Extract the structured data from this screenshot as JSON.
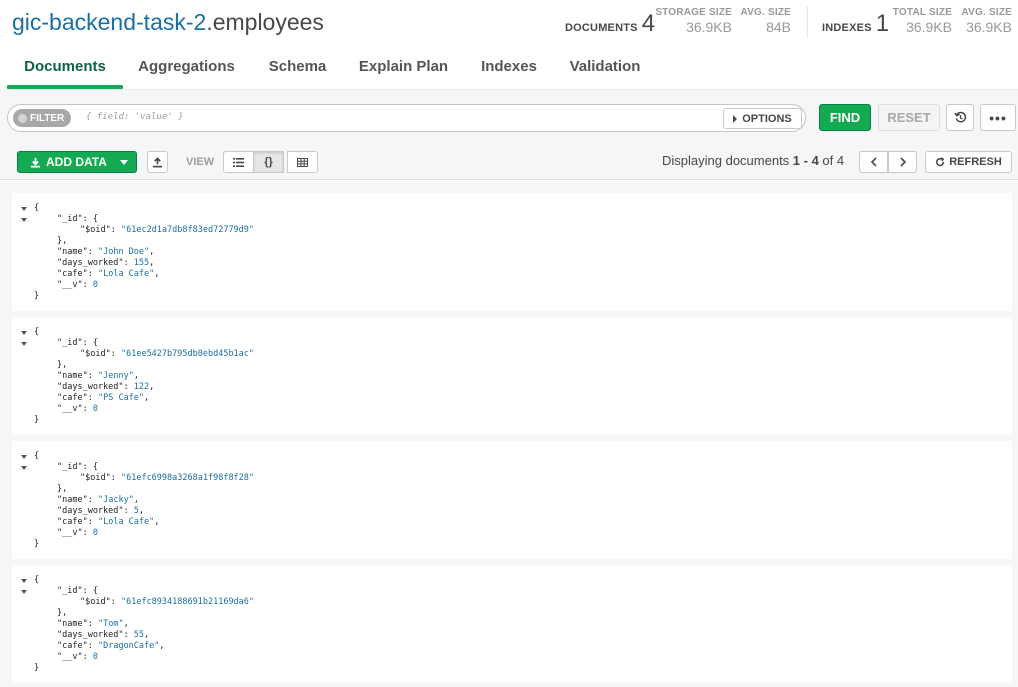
{
  "header": {
    "db": "gic-backend-task-2",
    "collection": ".employees",
    "documents_label": "DOCUMENTS",
    "documents_count": "4",
    "storage_size_label": "STORAGE SIZE",
    "storage_size": "36.9KB",
    "avg_size_label": "AVG. SIZE",
    "avg_size": "84B",
    "indexes_label": "INDEXES",
    "indexes_count": "1",
    "total_size_label": "TOTAL SIZE",
    "total_size": "36.9KB",
    "idx_avg_size_label": "AVG. SIZE",
    "idx_avg_size": "36.9KB"
  },
  "tabs": [
    {
      "label": "Documents",
      "active": true
    },
    {
      "label": "Aggregations"
    },
    {
      "label": "Schema"
    },
    {
      "label": "Explain Plan"
    },
    {
      "label": "Indexes"
    },
    {
      "label": "Validation"
    }
  ],
  "query": {
    "filter_label": "FILTER",
    "filter_placeholder": "{ field: 'value' }",
    "options_label": "OPTIONS",
    "find_label": "FIND",
    "reset_label": "RESET",
    "more_label": "•••"
  },
  "toolbar": {
    "add_data_label": "ADD DATA",
    "view_label": "VIEW",
    "view_json_label": "{}",
    "paging_prefix": "Displaying documents ",
    "paging_range": "1 - 4",
    "paging_of": " of ",
    "paging_total": "4",
    "refresh_label": "REFRESH"
  },
  "documents": [
    {
      "oid": "61ec2d1a7db8f83ed72779d9",
      "name": "John Doe",
      "days_worked": "155",
      "cafe": "Lola Cafe",
      "v": "0"
    },
    {
      "oid": "61ee5427b795db0ebd45b1ac",
      "name": "Jenny",
      "days_worked": "122",
      "cafe": "PS Cafe",
      "v": "0"
    },
    {
      "oid": "61efc6998a3268a1f98f8f28",
      "name": "Jacky",
      "days_worked": "5",
      "cafe": "Lola Cafe",
      "v": "0"
    },
    {
      "oid": "61efc8934188691b21169da6",
      "name": "Tom",
      "days_worked": "55",
      "cafe": "DragonCafe",
      "v": "0"
    }
  ],
  "syntax": {
    "open_brace": "{",
    "close_brace": "}",
    "close_brace_comma": "},",
    "id_key": "\"_id\"",
    "oid_key": "\"$oid\"",
    "name_key": "\"name\"",
    "days_key": "\"days_worked\"",
    "cafe_key": "\"cafe\"",
    "v_key": "\"__v\""
  },
  "colors": {
    "accent_green": "#13aa52",
    "db_blue": "#1a6fa5",
    "string_blue": "#1a6fa5"
  }
}
